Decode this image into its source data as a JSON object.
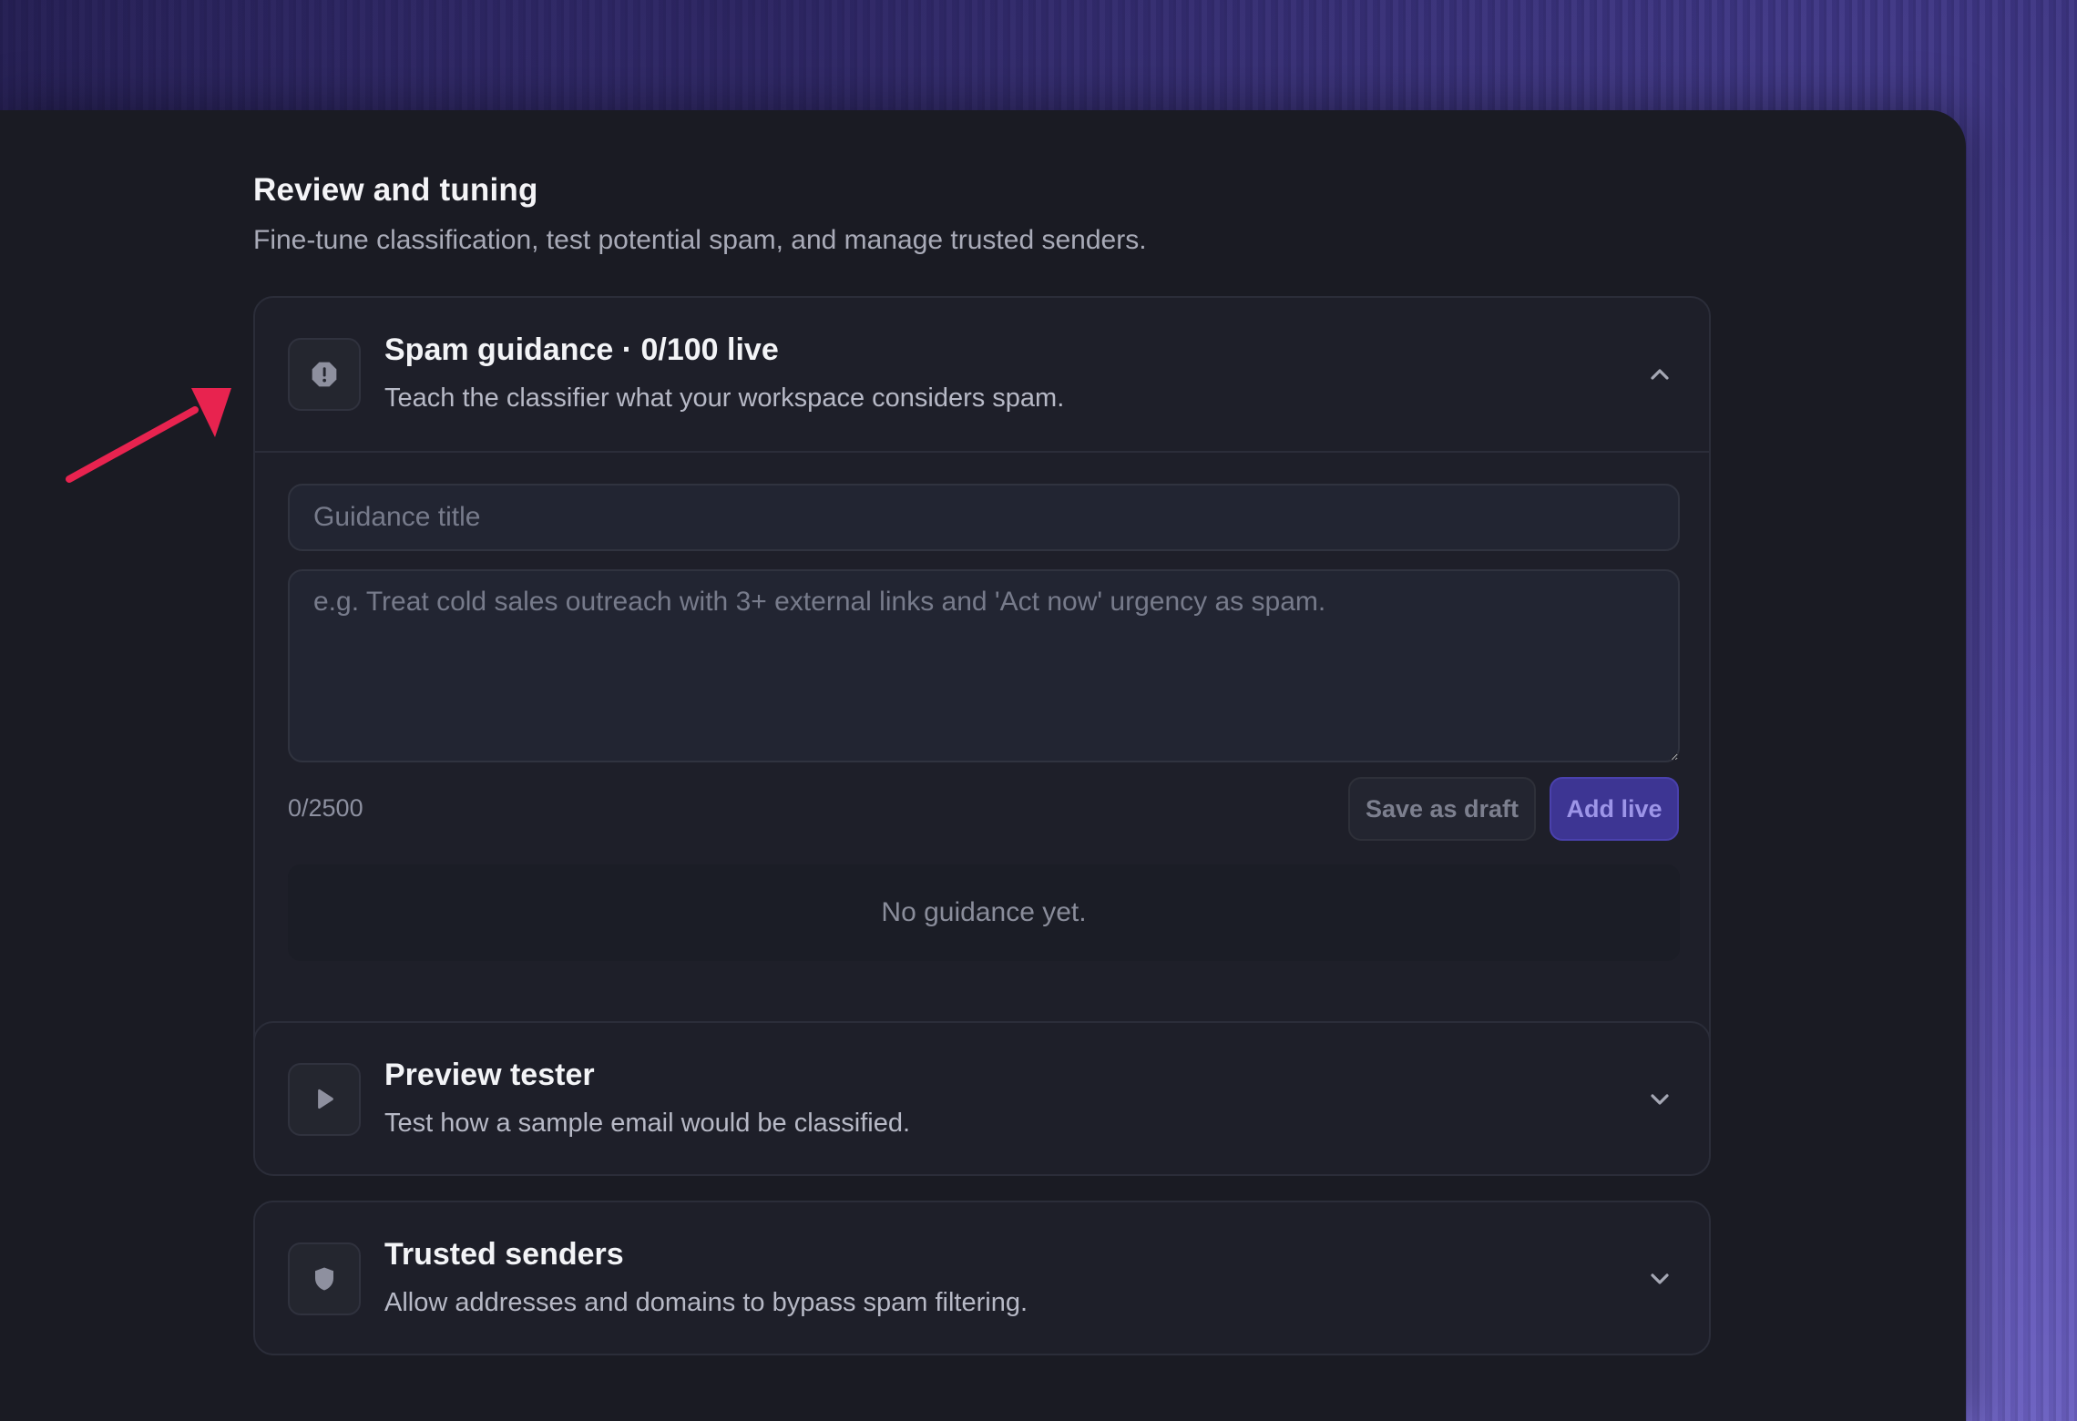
{
  "colors": {
    "accent": "#3d3593",
    "annotation_arrow": "#e8234f"
  },
  "section": {
    "title": "Review and tuning",
    "subtitle": "Fine-tune classification, test potential spam, and manage trusted senders."
  },
  "spam_guidance": {
    "icon": "alert-octagon-icon",
    "title": "Spam guidance · 0/100 live",
    "description": "Teach the classifier what your workspace considers spam.",
    "expanded": true,
    "title_input": {
      "placeholder": "Guidance title",
      "value": ""
    },
    "body_input": {
      "placeholder": "e.g. Treat cold sales outreach with 3+ external links and 'Act now' urgency as spam.",
      "value": ""
    },
    "char_count": "0/2500",
    "save_draft_label": "Save as draft",
    "add_live_label": "Add live",
    "empty_message": "No guidance yet."
  },
  "preview_tester": {
    "icon": "play-icon",
    "title": "Preview tester",
    "description": "Test how a sample email would be classified.",
    "expanded": false
  },
  "trusted_senders": {
    "icon": "shield-icon",
    "title": "Trusted senders",
    "description": "Allow addresses and domains to bypass spam filtering.",
    "expanded": false
  }
}
